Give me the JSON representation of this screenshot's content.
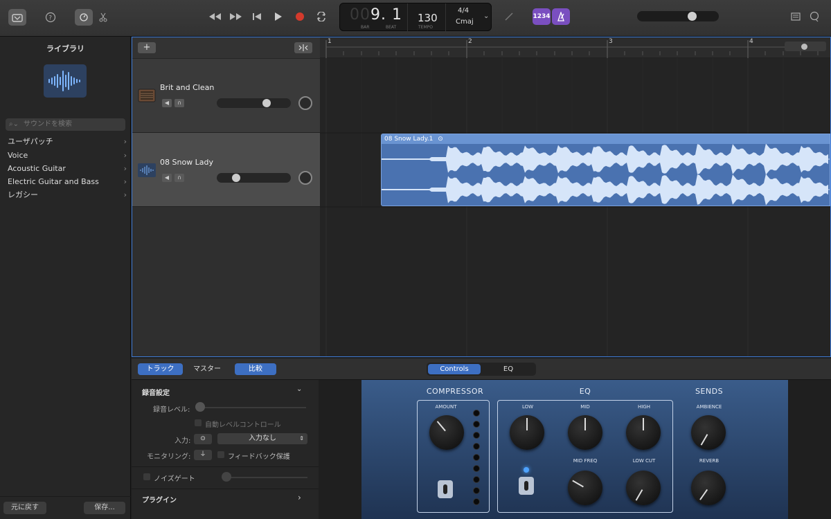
{
  "toolbar": {
    "lcd": {
      "bar_dim": "00",
      "position": "9. 1",
      "bar_label": "BAR",
      "beat_label": "BEAT",
      "tempo": "130",
      "tempo_label": "TEMPO",
      "signature": "4/4",
      "key": "Cmaj"
    },
    "count_in_label": "1234"
  },
  "library": {
    "title": "ライブラリ",
    "search_placeholder": "サウンドを検索",
    "items": [
      {
        "label": "ユーザパッチ"
      },
      {
        "label": "Voice"
      },
      {
        "label": "Acoustic Guitar"
      },
      {
        "label": "Electric Guitar and Bass"
      },
      {
        "label": "レガシー"
      }
    ],
    "revert_label": "元に戻す",
    "save_label": "保存..."
  },
  "tracks": {
    "add_label": "+",
    "items": [
      {
        "name": "Brit and Clean",
        "volume": 0.7
      },
      {
        "name": "08 Snow Lady",
        "volume": 0.22
      }
    ],
    "ruler": [
      "1",
      "2",
      "3",
      "4"
    ],
    "region_name": "08 Snow Lady.1"
  },
  "bottom": {
    "tab_track": "トラック",
    "tab_master": "マスター",
    "compare": "比較",
    "tab_controls": "Controls",
    "tab_eq": "EQ"
  },
  "settings": {
    "section": "録音設定",
    "rec_level": "録音レベル:",
    "auto_level": "自動レベルコントロール",
    "input": "入力:",
    "input_value": "入力なし",
    "monitoring": "モニタリング:",
    "feedback": "フィードバック保護",
    "noise_gate": "ノイズゲート",
    "plugins": "プラグイン"
  },
  "amp": {
    "compressor": "COMPRESSOR",
    "amount": "AMOUNT",
    "eq": "EQ",
    "low": "LOW",
    "mid": "MID",
    "high": "HIGH",
    "mid_freq": "MID FREQ",
    "low_cut": "LOW CUT",
    "sends": "SENDS",
    "ambience": "AMBIENCE",
    "reverb": "REVERB"
  }
}
